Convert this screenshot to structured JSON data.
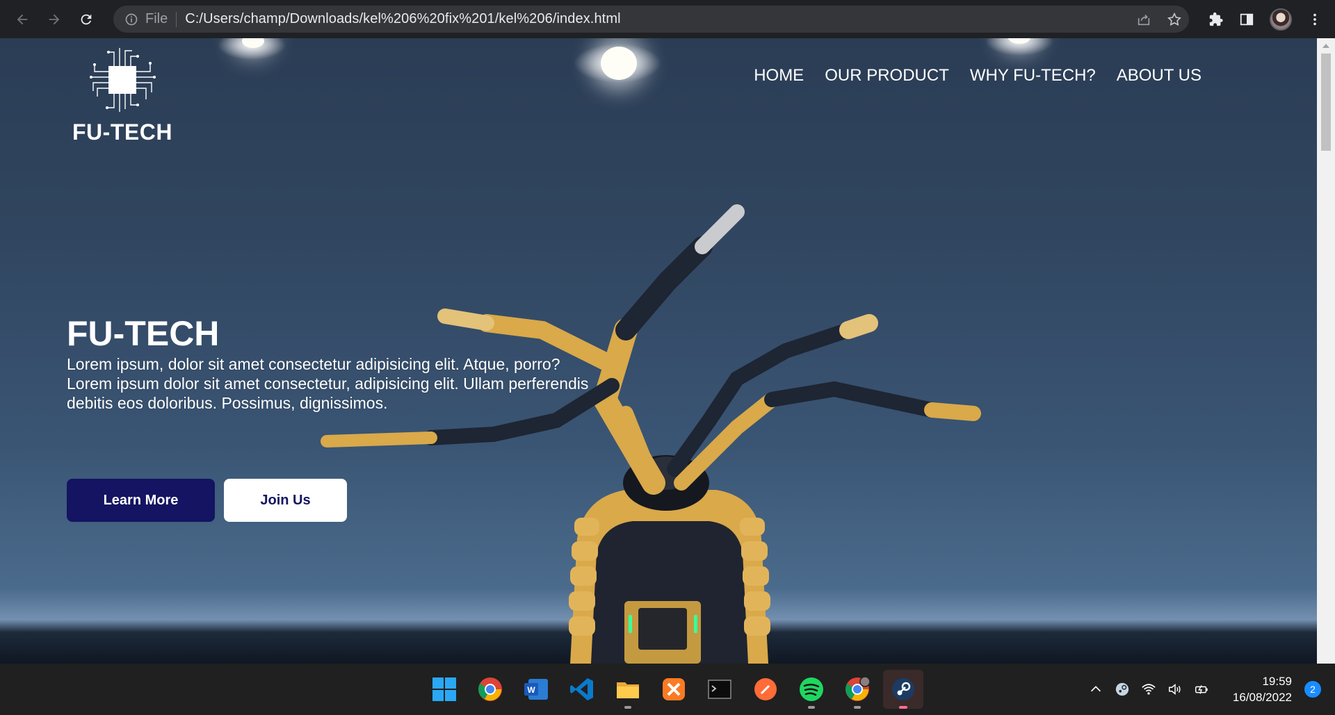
{
  "browser": {
    "file_label": "File",
    "url": "C:/Users/champ/Downloads/kel%206%20fix%201/kel%206/index.html"
  },
  "site": {
    "brand": "FU-TECH",
    "nav": [
      "HOME",
      "OUR PRODUCT",
      "WHY FU-TECH?",
      "ABOUT US"
    ],
    "hero": {
      "title": "FU-TECH",
      "text": "Lorem ipsum, dolor sit amet consectetur adipisicing elit. Atque, porro? Lorem ipsum dolor sit amet consectetur, adipisicing elit. Ullam perferendis debitis eos doloribus. Possimus, dignissimos.",
      "primary_button": "Learn More",
      "secondary_button": "Join Us"
    },
    "colors": {
      "button_primary": "#141462",
      "button_secondary": "#ffffff"
    }
  },
  "taskbar": {
    "apps": [
      "windows-start",
      "chrome",
      "word",
      "vscode",
      "file-explorer",
      "xampp",
      "terminal",
      "postman",
      "spotify",
      "chrome-profile",
      "steam"
    ],
    "clock_time": "19:59",
    "clock_date": "16/08/2022",
    "notification_count": "2"
  }
}
